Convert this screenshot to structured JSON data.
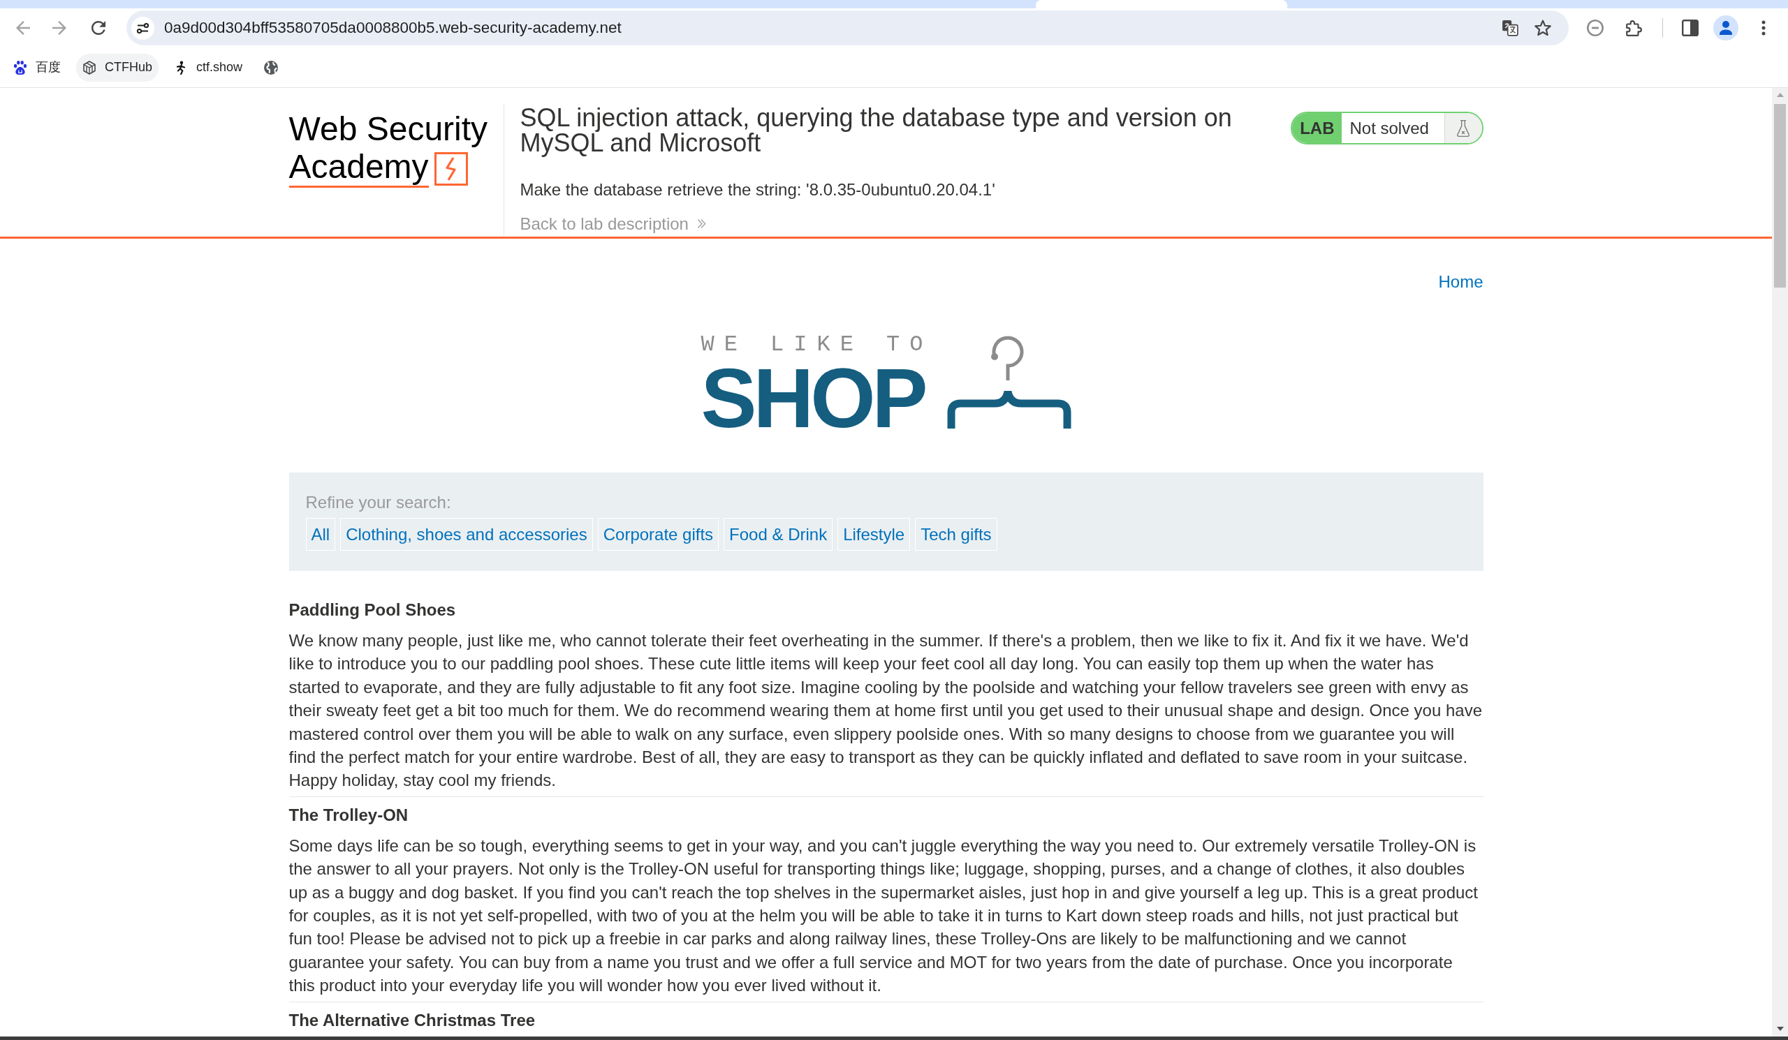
{
  "browser": {
    "url": "0a9d00d304bff53580705da0008800b5.web-security-academy.net",
    "bookmarks": [
      {
        "label": "百度",
        "highlighted": false
      },
      {
        "label": "CTFHub",
        "highlighted": true
      },
      {
        "label": "ctf.show",
        "highlighted": false
      }
    ]
  },
  "lab_header": {
    "logo": {
      "line_1": "Web Security",
      "line_2": "Academy"
    },
    "title": "SQL injection attack, querying the database type and version on MySQL and Microsoft",
    "instruction": "Make the database retrieve the string: '8.0.35-0ubuntu0.20.04.1'",
    "back_link": "Back to lab description",
    "badge": {
      "label": "LAB",
      "status": "Not solved"
    }
  },
  "shop": {
    "nav": [
      {
        "label": "Home"
      }
    ],
    "logo": {
      "tagline": "WE LIKE TO",
      "wordmark": "SHOP"
    },
    "filters": {
      "label": "Refine your search:",
      "items": [
        {
          "label": "All"
        },
        {
          "label": "Clothing, shoes and accessories"
        },
        {
          "label": "Corporate gifts"
        },
        {
          "label": "Food & Drink"
        },
        {
          "label": "Lifestyle"
        },
        {
          "label": "Tech gifts"
        }
      ]
    },
    "products": [
      {
        "name": "Paddling Pool Shoes",
        "description": "We know many people, just like me, who cannot tolerate their feet overheating in the summer. If there's a problem, then we like to fix it. And fix it we have. We'd like to introduce you to our paddling pool shoes. These cute little items will keep your feet cool all day long. You can easily top them up when the water has started to evaporate, and they are fully adjustable to fit any foot size. Imagine cooling by the poolside and watching your fellow travelers see green with envy as their sweaty feet get a bit too much for them. We do recommend wearing them at home first until you get used to their unusual shape and design. Once you have mastered control over them you will be able to walk on any surface, even slippery poolside ones. With so many designs to choose from we guarantee you will find the perfect match for your entire wardrobe. Best of all, they are easy to transport as they can be quickly inflated and deflated to save room in your suitcase. Happy holiday, stay cool my friends."
      },
      {
        "name": "The Trolley-ON",
        "description": "Some days life can be so tough, everything seems to get in your way, and you can't juggle everything the way you need to. Our extremely versatile Trolley-ON is the answer to all your prayers. Not only is the Trolley-ON useful for transporting things like; luggage, shopping, purses, and a change of clothes, it also doubles up as a buggy and dog basket. If you find you can't reach the top shelves in the supermarket aisles, just hop in and give yourself a leg up. This is a great product for couples, as it is not yet self-propelled, with two of you at the helm you will be able to take it in turns to Kart down steep roads and hills, not just practical but fun too! Please be advised not to pick up a freebie in car parks and along railway lines, these Trolley-Ons are likely to be malfunctioning and we cannot guarantee your safety. You can buy from a name you trust and we offer a full service and MOT for two years from the date of purchase. Once you incorporate this product into your everyday life you will wonder how you ever lived without it."
      },
      {
        "name": "The Alternative Christmas Tree"
      }
    ]
  }
}
